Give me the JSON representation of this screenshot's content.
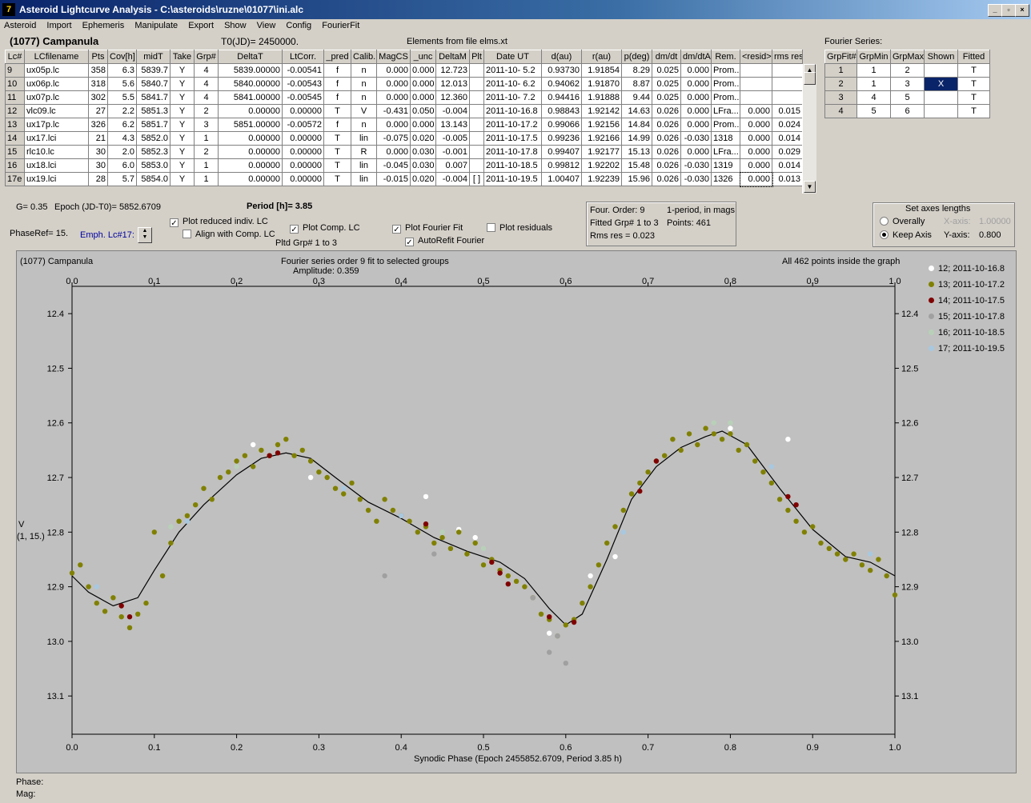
{
  "window": {
    "title": "Asteroid Lightcurve Analysis - C:\\asteroids\\ruzne\\01077\\ini.alc",
    "icon_name": "app-icon",
    "icon_glyph": "7"
  },
  "menu": [
    "Asteroid",
    "Import",
    "Ephemeris",
    "Manipulate",
    "Export",
    "Show",
    "View",
    "Config",
    "FourierFit"
  ],
  "header": {
    "asteroid": "(1077) Campanula",
    "t0": "T0(JD)= 2450000.",
    "elements": "Elements from file elms.xt"
  },
  "lc_table": {
    "columns": [
      "Lc#",
      "LCfilename",
      "Pts",
      "Cov[h]",
      "midT",
      "Take",
      "Grp#",
      "DeltaT",
      "LtCorr.",
      "_pred",
      "Calib.",
      "MagCS",
      "_unc",
      "DeltaM",
      "Plt",
      "Date UT",
      "d(au)",
      "r(au)",
      "p(deg)",
      "dm/dt",
      "dm/dtA",
      "Rem.",
      "<resid>",
      "rms res"
    ],
    "rows": [
      [
        "9",
        "ux05p.lc",
        "358",
        "6.3",
        "5839.7",
        "Y",
        "4",
        "5839.00000",
        "-0.00541",
        "f",
        "n",
        "0.000",
        "0.000",
        "12.723",
        "",
        "2011-10- 5.2",
        "0.93730",
        "1.91854",
        "8.29",
        "0.025",
        "0.000",
        "Prom...",
        "",
        ""
      ],
      [
        "10",
        "ux06p.lc",
        "318",
        "5.6",
        "5840.7",
        "Y",
        "4",
        "5840.00000",
        "-0.00543",
        "f",
        "n",
        "0.000",
        "0.000",
        "12.013",
        "",
        "2011-10- 6.2",
        "0.94062",
        "1.91870",
        "8.87",
        "0.025",
        "0.000",
        "Prom...",
        "",
        ""
      ],
      [
        "11",
        "ux07p.lc",
        "302",
        "5.5",
        "5841.7",
        "Y",
        "4",
        "5841.00000",
        "-0.00545",
        "f",
        "n",
        "0.000",
        "0.000",
        "12.360",
        "",
        "2011-10- 7.2",
        "0.94416",
        "1.91888",
        "9.44",
        "0.025",
        "0.000",
        "Prom...",
        "",
        ""
      ],
      [
        "12",
        "vlc09.lc",
        "27",
        "2.2",
        "5851.3",
        "Y",
        "2",
        "0.00000",
        "0.00000",
        "T",
        "V",
        "-0.431",
        "0.050",
        "-0.004",
        "",
        "2011-10-16.8",
        "0.98843",
        "1.92142",
        "14.63",
        "0.026",
        "0.000",
        "LFra...",
        "0.000",
        "0.015"
      ],
      [
        "13",
        "ux17p.lc",
        "326",
        "6.2",
        "5851.7",
        "Y",
        "3",
        "5851.00000",
        "-0.00572",
        "f",
        "n",
        "0.000",
        "0.000",
        "13.143",
        "",
        "2011-10-17.2",
        "0.99066",
        "1.92156",
        "14.84",
        "0.026",
        "0.000",
        "Prom...",
        "0.000",
        "0.024"
      ],
      [
        "14",
        "ux17.lci",
        "21",
        "4.3",
        "5852.0",
        "Y",
        "1",
        "0.00000",
        "0.00000",
        "T",
        "lin",
        "-0.075",
        "0.020",
        "-0.005",
        "",
        "2011-10-17.5",
        "0.99236",
        "1.92166",
        "14.99",
        "0.026",
        "-0.030",
        "1318",
        "0.000",
        "0.014"
      ],
      [
        "15",
        "rlc10.lc",
        "30",
        "2.0",
        "5852.3",
        "Y",
        "2",
        "0.00000",
        "0.00000",
        "T",
        "R",
        "0.000",
        "0.030",
        "-0.001",
        "",
        "2011-10-17.8",
        "0.99407",
        "1.92177",
        "15.13",
        "0.026",
        "0.000",
        "LFra...",
        "0.000",
        "0.029"
      ],
      [
        "16",
        "ux18.lci",
        "30",
        "6.0",
        "5853.0",
        "Y",
        "1",
        "0.00000",
        "0.00000",
        "T",
        "lin",
        "-0.045",
        "0.030",
        "0.007",
        "",
        "2011-10-18.5",
        "0.99812",
        "1.92202",
        "15.48",
        "0.026",
        "-0.030",
        "1319",
        "0.000",
        "0.014"
      ],
      [
        "17e",
        "ux19.lci",
        "28",
        "5.7",
        "5854.0",
        "Y",
        "1",
        "0.00000",
        "0.00000",
        "T",
        "lin",
        "-0.015",
        "0.020",
        "-0.004",
        "[ ]",
        "2011-10-19.5",
        "1.00407",
        "1.92239",
        "15.96",
        "0.026",
        "-0.030",
        "1326",
        "0.000",
        "0.013"
      ]
    ]
  },
  "fourier_table": {
    "label": "Fourier Series:",
    "columns": [
      "GrpFit#",
      "GrpMin",
      "GrpMax",
      "Shown",
      "Fitted"
    ],
    "rows": [
      [
        "1",
        "1",
        "2",
        "",
        "T"
      ],
      [
        "2",
        "1",
        "3",
        "X",
        "T"
      ],
      [
        "3",
        "4",
        "5",
        "",
        "T"
      ],
      [
        "4",
        "5",
        "6",
        "",
        "T"
      ]
    ]
  },
  "params": {
    "g": "G= 0.35",
    "epoch": "Epoch (JD-T0)= 5852.6709",
    "period": "Period [h]= 3.85",
    "phase_ref": "PhaseRef= 15.",
    "emph_lc": "Emph. Lc#17:",
    "plot_reduced": "Plot reduced indiv. LC",
    "align_comp": "Align with Comp. LC",
    "plot_comp": "Plot Comp. LC",
    "pltd_grp": "Pltd Grp#  1   to    3",
    "plot_fourier": "Plot Fourier Fit",
    "autorefit": "AutoRefit Fourier",
    "plot_residuals": "Plot residuals"
  },
  "fourier_info": {
    "order": "Four. Order:  9",
    "mode": "1-period, in mags",
    "fitted": "Fitted Grp# 1 to 3",
    "points": "Points: 461",
    "rms": "Rms res     = 0.023"
  },
  "axes_box": {
    "title": "Set axes lengths",
    "overally": "Overally",
    "keep": "Keep Axis",
    "xaxis_label": "X-axis:",
    "xaxis_val": "1.00000",
    "yaxis_label": "Y-axis:",
    "yaxis_val": "0.800"
  },
  "plot_header": {
    "left": "(1077) Campanula",
    "center1": "Fourier series order 9 fit to selected groups",
    "center2": "Amplitude: 0.359",
    "right": "All 462 points inside the graph"
  },
  "y_axis_label": [
    "V",
    "(1, 15.)"
  ],
  "status": {
    "phase": "Phase:",
    "mag": "Mag:"
  },
  "colors": {
    "plot_bg": "#c0c0c0",
    "panel_bg": "#d4d0c8",
    "selected_cell": "#0a246a"
  },
  "chart_data": {
    "type": "scatter",
    "xlabel": "Synodic Phase (Epoch 2455852.6709, Period 3.85 h)",
    "ylabel": "V (1, 15.)",
    "xlim": [
      0,
      1
    ],
    "ylim": [
      13.17,
      12.35
    ],
    "y_inverted": true,
    "x_ticks": [
      "0.0",
      "0.1",
      "0.2",
      "0.3",
      "0.4",
      "0.5",
      "0.6",
      "0.7",
      "0.8",
      "0.9",
      "1.0"
    ],
    "y_ticks": [
      "12.4",
      "12.5",
      "12.6",
      "12.7",
      "12.8",
      "12.9",
      "13.0",
      "13.1"
    ],
    "fit_curve": [
      [
        0,
        12.88
      ],
      [
        0.02,
        12.91
      ],
      [
        0.05,
        12.935
      ],
      [
        0.08,
        12.92
      ],
      [
        0.1,
        12.87
      ],
      [
        0.13,
        12.8
      ],
      [
        0.16,
        12.75
      ],
      [
        0.2,
        12.695
      ],
      [
        0.23,
        12.665
      ],
      [
        0.26,
        12.655
      ],
      [
        0.29,
        12.665
      ],
      [
        0.32,
        12.7
      ],
      [
        0.36,
        12.745
      ],
      [
        0.4,
        12.775
      ],
      [
        0.44,
        12.81
      ],
      [
        0.48,
        12.835
      ],
      [
        0.52,
        12.855
      ],
      [
        0.55,
        12.885
      ],
      [
        0.58,
        12.94
      ],
      [
        0.6,
        12.97
      ],
      [
        0.62,
        12.95
      ],
      [
        0.65,
        12.85
      ],
      [
        0.68,
        12.74
      ],
      [
        0.71,
        12.68
      ],
      [
        0.74,
        12.645
      ],
      [
        0.77,
        12.625
      ],
      [
        0.79,
        12.615
      ],
      [
        0.82,
        12.64
      ],
      [
        0.86,
        12.72
      ],
      [
        0.9,
        12.795
      ],
      [
        0.94,
        12.845
      ],
      [
        0.97,
        12.855
      ],
      [
        1.0,
        12.88
      ]
    ],
    "series": [
      {
        "name": "12; 2011-10-16.8",
        "color": "#ffffff",
        "points": [
          [
            0.22,
            12.64
          ],
          [
            0.43,
            12.735
          ],
          [
            0.47,
            12.795
          ],
          [
            0.49,
            12.81
          ],
          [
            0.58,
            12.985
          ],
          [
            0.63,
            12.88
          ],
          [
            0.8,
            12.61
          ],
          [
            0.87,
            12.63
          ],
          [
            0.29,
            12.7
          ],
          [
            0.66,
            12.845
          ]
        ]
      },
      {
        "name": "13; 2011-10-17.2",
        "color": "#808000",
        "points": [
          [
            0.0,
            12.875
          ],
          [
            0.01,
            12.86
          ],
          [
            0.02,
            12.9
          ],
          [
            0.03,
            12.93
          ],
          [
            0.04,
            12.945
          ],
          [
            0.05,
            12.92
          ],
          [
            0.06,
            12.955
          ],
          [
            0.07,
            12.975
          ],
          [
            0.08,
            12.95
          ],
          [
            0.09,
            12.93
          ],
          [
            0.1,
            12.8
          ],
          [
            0.11,
            12.88
          ],
          [
            0.12,
            12.82
          ],
          [
            0.13,
            12.78
          ],
          [
            0.14,
            12.77
          ],
          [
            0.15,
            12.75
          ],
          [
            0.16,
            12.72
          ],
          [
            0.17,
            12.74
          ],
          [
            0.18,
            12.7
          ],
          [
            0.19,
            12.69
          ],
          [
            0.2,
            12.67
          ],
          [
            0.21,
            12.66
          ],
          [
            0.22,
            12.68
          ],
          [
            0.23,
            12.65
          ],
          [
            0.24,
            12.66
          ],
          [
            0.25,
            12.64
          ],
          [
            0.26,
            12.63
          ],
          [
            0.27,
            12.66
          ],
          [
            0.28,
            12.65
          ],
          [
            0.29,
            12.67
          ],
          [
            0.3,
            12.69
          ],
          [
            0.31,
            12.7
          ],
          [
            0.32,
            12.72
          ],
          [
            0.33,
            12.73
          ],
          [
            0.34,
            12.71
          ],
          [
            0.35,
            12.74
          ],
          [
            0.36,
            12.76
          ],
          [
            0.37,
            12.78
          ],
          [
            0.38,
            12.74
          ],
          [
            0.39,
            12.76
          ],
          [
            0.4,
            12.77
          ],
          [
            0.41,
            12.78
          ],
          [
            0.42,
            12.8
          ],
          [
            0.43,
            12.79
          ],
          [
            0.44,
            12.82
          ],
          [
            0.45,
            12.81
          ],
          [
            0.46,
            12.83
          ],
          [
            0.47,
            12.8
          ],
          [
            0.48,
            12.84
          ],
          [
            0.49,
            12.82
          ],
          [
            0.5,
            12.86
          ],
          [
            0.51,
            12.85
          ],
          [
            0.52,
            12.87
          ],
          [
            0.53,
            12.88
          ],
          [
            0.54,
            12.89
          ],
          [
            0.55,
            12.9
          ],
          [
            0.56,
            12.92
          ],
          [
            0.57,
            12.95
          ],
          [
            0.58,
            12.96
          ],
          [
            0.59,
            12.99
          ],
          [
            0.6,
            12.97
          ],
          [
            0.61,
            12.96
          ],
          [
            0.62,
            12.93
          ],
          [
            0.63,
            12.9
          ],
          [
            0.64,
            12.86
          ],
          [
            0.65,
            12.82
          ],
          [
            0.66,
            12.79
          ],
          [
            0.67,
            12.76
          ],
          [
            0.68,
            12.73
          ],
          [
            0.69,
            12.71
          ],
          [
            0.7,
            12.69
          ],
          [
            0.71,
            12.67
          ],
          [
            0.72,
            12.66
          ],
          [
            0.73,
            12.63
          ],
          [
            0.74,
            12.65
          ],
          [
            0.75,
            12.62
          ],
          [
            0.76,
            12.64
          ],
          [
            0.77,
            12.61
          ],
          [
            0.78,
            12.62
          ],
          [
            0.79,
            12.63
          ],
          [
            0.8,
            12.62
          ],
          [
            0.81,
            12.65
          ],
          [
            0.82,
            12.64
          ],
          [
            0.83,
            12.67
          ],
          [
            0.84,
            12.69
          ],
          [
            0.85,
            12.71
          ],
          [
            0.86,
            12.74
          ],
          [
            0.87,
            12.76
          ],
          [
            0.88,
            12.78
          ],
          [
            0.89,
            12.8
          ],
          [
            0.9,
            12.79
          ],
          [
            0.91,
            12.82
          ],
          [
            0.92,
            12.83
          ],
          [
            0.93,
            12.84
          ],
          [
            0.94,
            12.85
          ],
          [
            0.95,
            12.84
          ],
          [
            0.96,
            12.86
          ],
          [
            0.97,
            12.87
          ],
          [
            0.98,
            12.85
          ],
          [
            0.99,
            12.88
          ],
          [
            1.0,
            12.915
          ]
        ]
      },
      {
        "name": "14; 2011-10-17.5",
        "color": "#800000",
        "points": [
          [
            0.06,
            12.935
          ],
          [
            0.07,
            12.955
          ],
          [
            0.24,
            12.66
          ],
          [
            0.25,
            12.655
          ],
          [
            0.43,
            12.785
          ],
          [
            0.51,
            12.855
          ],
          [
            0.52,
            12.875
          ],
          [
            0.53,
            12.895
          ],
          [
            0.58,
            12.955
          ],
          [
            0.61,
            12.965
          ],
          [
            0.69,
            12.725
          ],
          [
            0.71,
            12.67
          ],
          [
            0.87,
            12.735
          ],
          [
            0.88,
            12.75
          ]
        ]
      },
      {
        "name": "15; 2011-10-17.8",
        "color": "#a0a0a0",
        "points": [
          [
            0.38,
            12.88
          ],
          [
            0.58,
            13.02
          ],
          [
            0.6,
            13.04
          ],
          [
            0.59,
            12.99
          ],
          [
            0.44,
            12.84
          ],
          [
            0.56,
            12.92
          ]
        ]
      },
      {
        "name": "16; 2011-10-18.5",
        "color": "#b8d0b8",
        "points": [
          [
            0.12,
            12.79
          ],
          [
            0.2,
            12.68
          ],
          [
            0.45,
            12.8
          ],
          [
            0.5,
            12.83
          ],
          [
            0.78,
            12.6
          ],
          [
            0.8,
            12.6
          ]
        ]
      },
      {
        "name": "17; 2011-10-19.5",
        "color": "#a8c8e0",
        "points": [
          [
            0.03,
            12.9
          ],
          [
            0.14,
            12.78
          ],
          [
            0.33,
            12.72
          ],
          [
            0.4,
            12.77
          ],
          [
            0.67,
            12.8
          ],
          [
            0.85,
            12.68
          ],
          [
            0.97,
            12.84
          ]
        ]
      }
    ]
  }
}
